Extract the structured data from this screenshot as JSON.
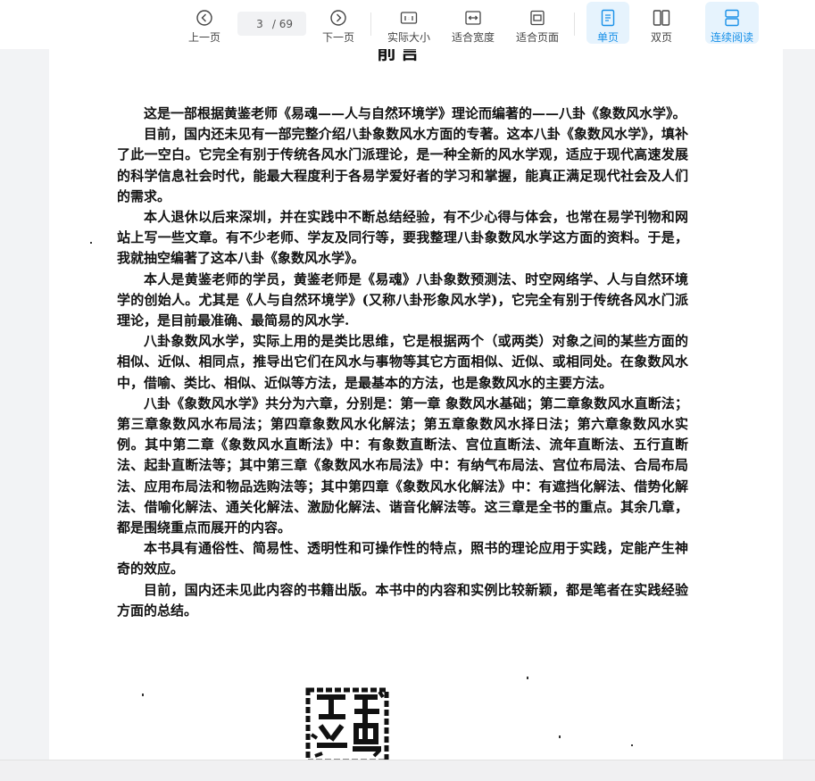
{
  "toolbar": {
    "prev_label": "上一页",
    "current_page": "3",
    "page_total": "/ 69",
    "next_label": "下一页",
    "actual_size_label": "实际大小",
    "fit_width_label": "适合宽度",
    "fit_page_label": "适合页面",
    "single_page_label": "单页",
    "double_page_label": "双页",
    "continuous_label": "连续阅读"
  },
  "accent_color": "#1890e8",
  "document": {
    "heading": "前言",
    "paragraphs": [
      "这是一部根据黄鉴老师《易魂——人与自然环境学》理论而编著的——八卦《象数风水学》。",
      "目前，国内还未见有一部完整介绍八卦象数风水方面的专著。这本八卦《象数风水学》，填补了此一空白。它完全有别于传统各风水门派理论，是一种全新的风水学观，适应于现代高速发展的科学信息社会时代，能最大程度利于各易学爱好者的学习和掌握，能真正满足现代社会及人们的需求。",
      "本人退休以后来深圳，并在实践中不断总结经验，有不少心得与体会，也常在易学刊物和网站上写一些文章。有不少老师、学友及同行等，要我整理八卦象数风水学这方面的资料。于是，我就抽空编著了这本八卦《象数风水学》。",
      "本人是黄鉴老师的学员，黄鉴老师是《易魂》八卦象数预测法、时空网络学、人与自然环境学的创始人。尤其是《人与自然环境学》(又称八卦形象风水学)，它完全有别于传统各风水门派理论，是目前最准确、最简易的风水学.",
      "八卦象数风水学，实际上用的是类比思维，它是根据两个（或两类）对象之间的某些方面的相似、近似、相同点，推导出它们在风水与事物等其它方面相似、近似、或相同处。在象数风水中，借喻、类比、相似、近似等方法，是最基本的方法，也是象数风水的主要方法。",
      "八卦《象数风水学》共分为六章，分别是：第一章 象数风水基础；第二章象数风水直断法；第三章象数风水布局法；第四章象数风水化解法；第五章象数风水择日法；第六章象数风水实例。其中第二章《象数风水直断法》中：有象数直断法、宫位直断法、流年直断法、五行直断法、起卦直断法等；其中第三章《象数风水布局法》中：有纳气布局法、宫位布局法、合局布局法、应用布局法和物品选购法等；其中第四章《象数风水化解法》中：有遮挡化解法、借势化解法、借喻化解法、通关化解法、激励化解法、谐音化解法等。这三章是全书的重点。其余几章，都是围绕重点而展开的内容。",
      "本书具有通俗性、简易性、透明性和可操作性的特点，照书的理论应用于实践，定能产生神奇的效应。",
      "目前，国内还未见此内容的书籍出版。本书中的内容和实例比较新颖，都是笔者在实践经验方面的总结。"
    ]
  },
  "icons": {
    "prev": "chevron-left-circle-icon",
    "next": "chevron-right-circle-icon",
    "actual_size": "one-to-one-icon",
    "fit_width": "fit-width-icon",
    "fit_page": "fit-page-icon",
    "single_page": "single-page-icon",
    "double_page": "double-page-icon",
    "continuous": "continuous-scroll-icon",
    "seal": "seal-stamp-icon"
  }
}
